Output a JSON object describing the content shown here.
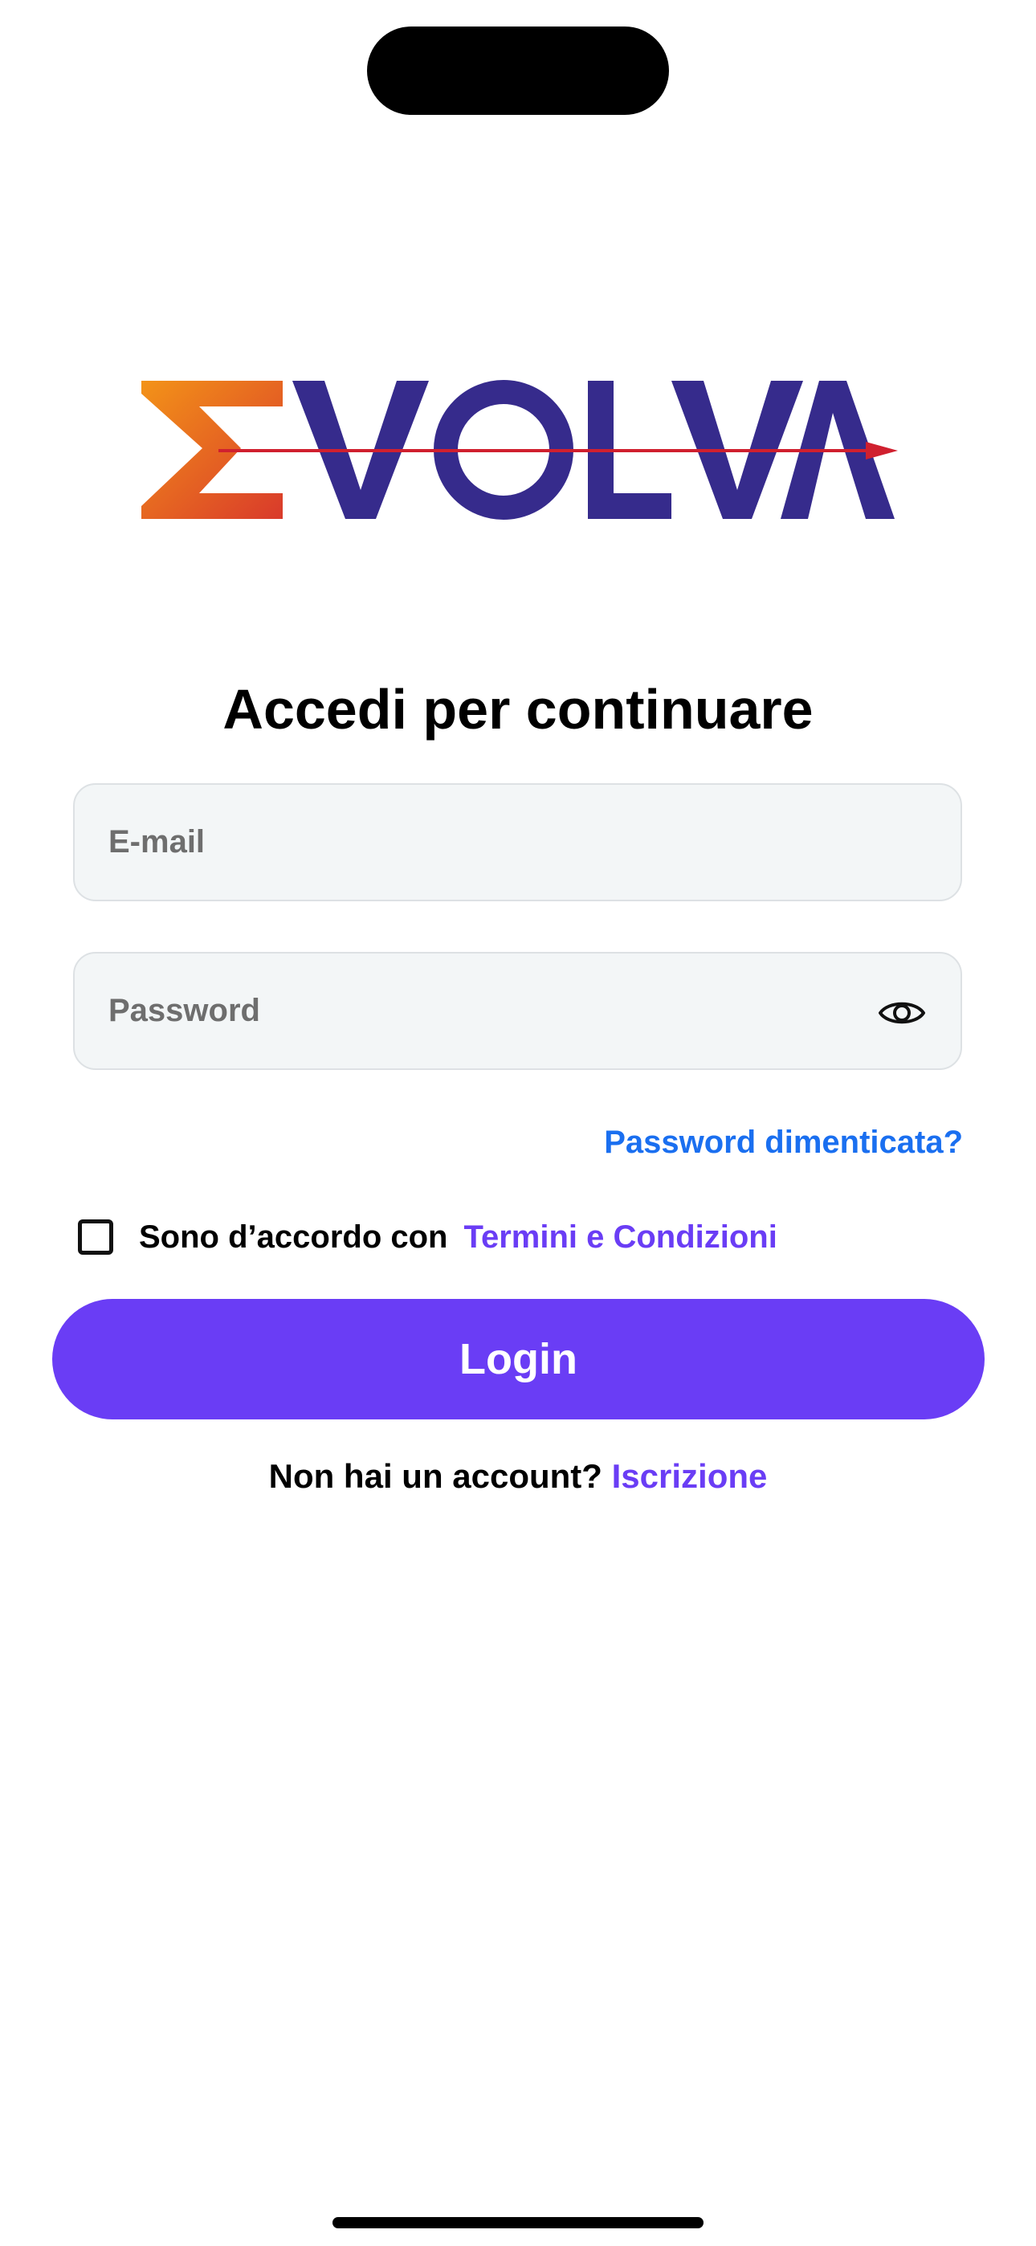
{
  "logo": {
    "text": "EVOLVA",
    "colors": {
      "sigma_gradient_start": "#f39318",
      "sigma_gradient_end": "#d93a2b",
      "letters": "#362b8c",
      "arrow": "#d0202f"
    }
  },
  "login": {
    "title": "Accedi per continuare",
    "email_placeholder": "E-mail",
    "email_value": "",
    "password_placeholder": "Password",
    "password_value": "",
    "show_password_icon": "eye-icon",
    "forgot_password": "Password dimenticata?",
    "terms_prefix": "Sono d’accordo con",
    "terms_link": "Termini e Condizioni",
    "terms_checked": false,
    "login_button": "Login",
    "signup_question": "Non hai un account?",
    "signup_link": "Iscrizione"
  },
  "colors": {
    "accent": "#6a3df5",
    "link_blue": "#1a6ff0",
    "field_bg": "#f3f6f7",
    "field_border": "#dde1e4"
  }
}
